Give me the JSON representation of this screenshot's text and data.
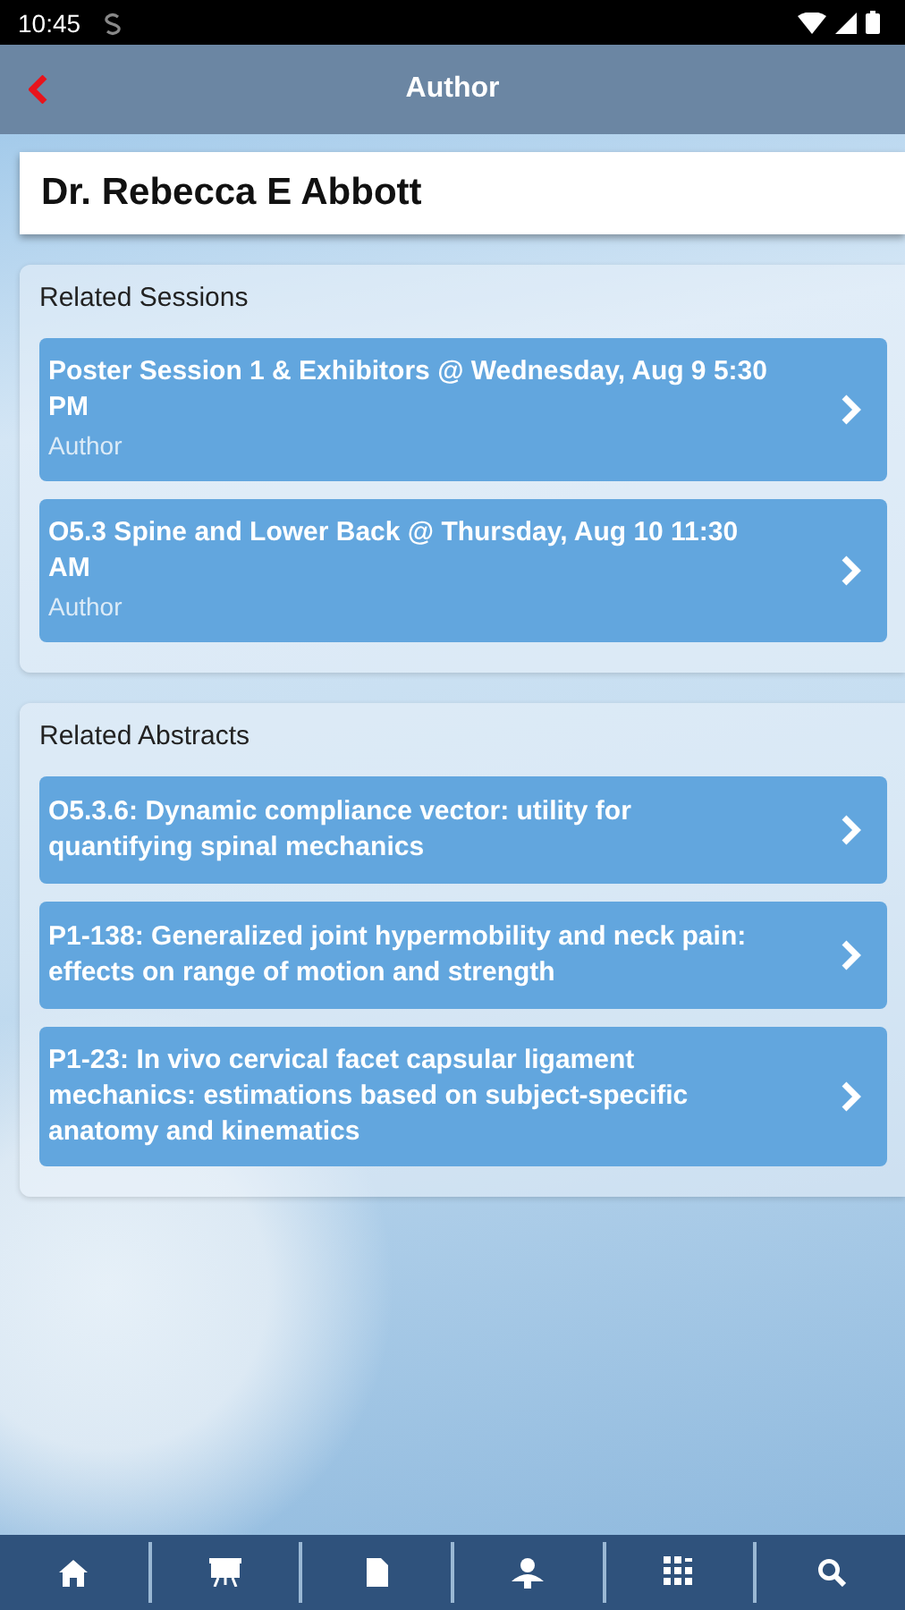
{
  "status_bar": {
    "time": "10:45"
  },
  "header": {
    "title": "Author"
  },
  "author": {
    "name": "Dr. Rebecca E Abbott"
  },
  "sections": [
    {
      "heading": "Related Sessions",
      "items": [
        {
          "title": "Poster Session 1 & Exhibitors @ Wednesday, Aug 9 5:30 PM",
          "subtitle": "Author"
        },
        {
          "title": "O5.3 Spine and Lower Back @ Thursday, Aug 10 11:30 AM",
          "subtitle": "Author"
        }
      ]
    },
    {
      "heading": "Related Abstracts",
      "items": [
        {
          "title": "O5.3.6: Dynamic compliance vector: utility for quantifying spinal mechanics"
        },
        {
          "title": "P1-138: Generalized joint hypermobility and neck pain: effects on range of motion and strength"
        },
        {
          "title": "P1-23: In vivo cervical facet capsular ligament mechanics: estimations based on subject-specific anatomy and kinematics"
        }
      ]
    }
  ]
}
